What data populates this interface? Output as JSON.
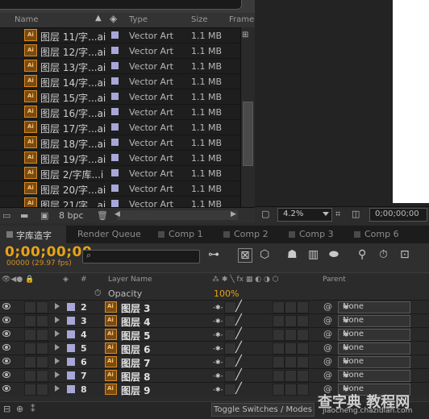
{
  "project_panel": {
    "columns": {
      "name": "Name",
      "type": "Type",
      "size": "Size",
      "frame": "Frame"
    },
    "items": [
      {
        "name": "图层 11/字...ai",
        "type": "Vector Art",
        "size": "1.1 MB"
      },
      {
        "name": "图层 12/字...ai",
        "type": "Vector Art",
        "size": "1.1 MB"
      },
      {
        "name": "图层 13/字...ai",
        "type": "Vector Art",
        "size": "1.1 MB"
      },
      {
        "name": "图层 14/字...ai",
        "type": "Vector Art",
        "size": "1.1 MB"
      },
      {
        "name": "图层 15/字...ai",
        "type": "Vector Art",
        "size": "1.1 MB"
      },
      {
        "name": "图层 16/字...ai",
        "type": "Vector Art",
        "size": "1.1 MB"
      },
      {
        "name": "图层 17/字...ai",
        "type": "Vector Art",
        "size": "1.1 MB"
      },
      {
        "name": "图层 18/字...ai",
        "type": "Vector Art",
        "size": "1.1 MB"
      },
      {
        "name": "图层 19/字...ai",
        "type": "Vector Art",
        "size": "1.1 MB"
      },
      {
        "name": "图层 2/字库...i",
        "type": "Vector Art",
        "size": "1.1 MB"
      },
      {
        "name": "图层 20/字...ai",
        "type": "Vector Art",
        "size": "1.1 MB"
      },
      {
        "name": "图层 21/字...ai",
        "type": "Vector Art",
        "size": "1.1 MB"
      }
    ],
    "footer": {
      "bpc": "8 bpc"
    }
  },
  "viewer": {
    "zoom": "4.2%",
    "timecode": "0;00;00;00"
  },
  "tabs": [
    {
      "label": "字库造字",
      "active": true
    },
    {
      "label": "Render Queue",
      "active": false
    },
    {
      "label": "Comp 1",
      "active": false
    },
    {
      "label": "Comp 2",
      "active": false
    },
    {
      "label": "Comp 3",
      "active": false
    },
    {
      "label": "Comp 6",
      "active": false
    }
  ],
  "timeline": {
    "timecode": "0;00;00;00",
    "fps": "00000 (29.97 fps)",
    "columns": {
      "hash": "#",
      "layer_name": "Layer Name",
      "parent": "Parent"
    },
    "opacity": {
      "label": "Opacity",
      "value": "100%"
    },
    "layers": [
      {
        "num": "2",
        "name": "图层 3",
        "parent": "None"
      },
      {
        "num": "3",
        "name": "图层 4",
        "parent": "None"
      },
      {
        "num": "4",
        "name": "图层 5",
        "parent": "None"
      },
      {
        "num": "5",
        "name": "图层 6",
        "parent": "None"
      },
      {
        "num": "6",
        "name": "图层 7",
        "parent": "None"
      },
      {
        "num": "7",
        "name": "图层 8",
        "parent": "None"
      },
      {
        "num": "8",
        "name": "图层 9",
        "parent": "None"
      }
    ],
    "footer": {
      "toggle": "Toggle Switches / Modes"
    }
  },
  "watermark": {
    "main": "查字典 教程网",
    "sub": "jiaocheng.chazidian.com"
  },
  "colors": {
    "timecode": "#e8a317",
    "label_swatch": "#a9a6d8",
    "ai_icon": "#d68a1e"
  }
}
